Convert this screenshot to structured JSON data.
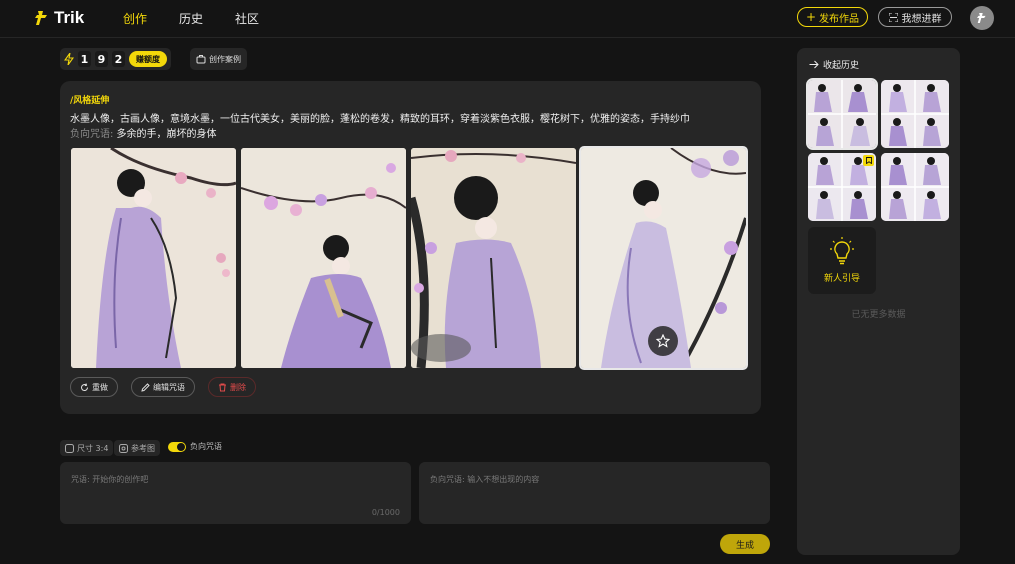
{
  "app": {
    "name": "Trik"
  },
  "nav": {
    "items": [
      "创作",
      "历史",
      "社区"
    ],
    "active": "创作"
  },
  "header": {
    "publish_label": "发布作品",
    "join_group_label": "我想进群"
  },
  "credits": {
    "digits": [
      "1",
      "9",
      "2"
    ],
    "earn_label": "赚额度"
  },
  "cases_label": "创作案例",
  "work": {
    "style_tag": "/风格延伸",
    "prompt": "水墨人像，古画人像，意境水墨，一位古代美女，美丽的脸，蓬松的卷发，精致的耳环，穿着淡紫色衣服，樱花树下，优雅的姿态，手持纱巾",
    "negative_label": "负向咒语:",
    "negative_text": " 多余的手，崩坏的身体",
    "images": [
      {
        "desc": "ink-painting woman with plum blossoms"
      },
      {
        "desc": "ink-painting woman with plum blossoms"
      },
      {
        "desc": "ink-painting woman with plum blossoms"
      },
      {
        "desc": "ink-painting woman with plum blossoms",
        "selected": true
      }
    ],
    "actions": {
      "redo": "重做",
      "edit": "编辑咒语",
      "delete": "删除"
    }
  },
  "options": {
    "size_label": "尺寸 3:4",
    "ref_label": "参考图",
    "neg_toggle_label": "负向咒语",
    "neg_toggle_on": true
  },
  "inputs": {
    "prompt_placeholder": "咒语: 开始你的创作吧",
    "prompt_counter": "0/1000",
    "negative_placeholder": "负向咒语: 输入不想出现的内容"
  },
  "generate_label": "生成",
  "history": {
    "header": "收起历史",
    "guide_label": "新人引导",
    "empty_text": "已无更多数据"
  },
  "colors": {
    "accent": "#f3d80a",
    "danger": "#e24b4b",
    "panel": "#262626",
    "bg": "#141414"
  }
}
